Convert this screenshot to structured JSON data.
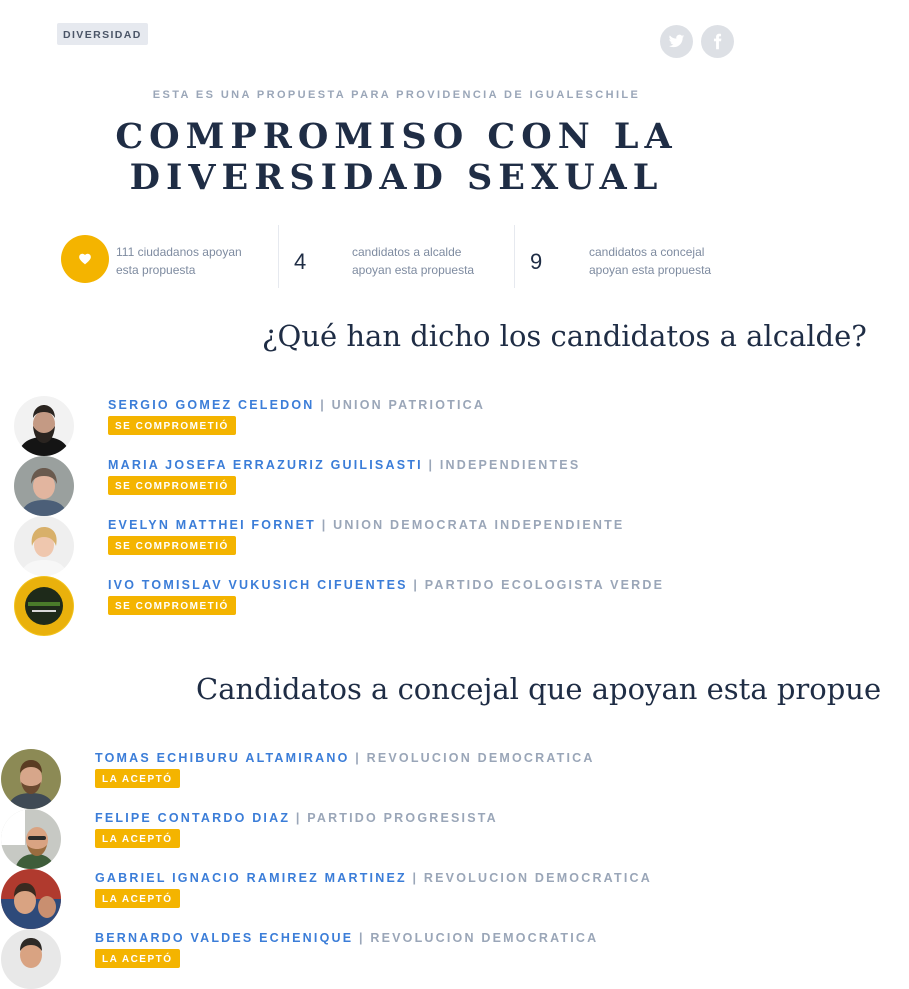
{
  "tag": "DIVERSIDAD",
  "social": {
    "twitter_icon": "twitter-icon",
    "facebook_icon": "facebook-icon"
  },
  "kicker": "ESTA ES UNA PROPUESTA PARA PROVIDENCIA DE IGUALESCHILE",
  "title_line1": "COMPROMISO CON LA",
  "title_line2": "DIVERSIDAD SEXUAL",
  "stats": {
    "citizens": "111 ciudadanos apoyan esta propuesta",
    "mayor_count": "4",
    "mayor_label": "candidatos a alcalde apoyan esta propuesta",
    "council_count": "9",
    "council_label": "candidatos a concejal apoyan esta propuesta"
  },
  "mayor_section": {
    "heading": "¿Qué han dicho los candidatos a alcalde?",
    "candidates": [
      {
        "name": "SERGIO GOMEZ CELEDON",
        "sep": "|",
        "party": "UNION PATRIOTICA",
        "badge": "SE COMPROMETIÓ"
      },
      {
        "name": "MARIA JOSEFA ERRAZURIZ GUILISASTI",
        "sep": "|",
        "party": "INDEPENDIENTES",
        "badge": "SE COMPROMETIÓ"
      },
      {
        "name": "EVELYN MATTHEI FORNET",
        "sep": "|",
        "party": "UNION DEMOCRATA INDEPENDIENTE",
        "badge": "SE COMPROMETIÓ"
      },
      {
        "name": "IVO TOMISLAV VUKUSICH CIFUENTES",
        "sep": "|",
        "party": "PARTIDO ECOLOGISTA VERDE",
        "badge": "SE COMPROMETIÓ"
      }
    ]
  },
  "council_section": {
    "heading": "Candidatos a concejal que apoyan esta propue",
    "candidates": [
      {
        "name": "TOMAS ECHIBURU ALTAMIRANO",
        "sep": "|",
        "party": "REVOLUCION DEMOCRATICA",
        "badge": "LA ACEPTÓ"
      },
      {
        "name": "FELIPE CONTARDO DIAZ",
        "sep": "|",
        "party": "PARTIDO PROGRESISTA",
        "badge": "LA ACEPTÓ"
      },
      {
        "name": "GABRIEL IGNACIO RAMIREZ MARTINEZ",
        "sep": "|",
        "party": "REVOLUCION DEMOCRATICA",
        "badge": "LA ACEPTÓ"
      },
      {
        "name": "BERNARDO VALDES ECHENIQUE",
        "sep": "|",
        "party": "REVOLUCION DEMOCRATICA",
        "badge": "LA ACEPTÓ"
      }
    ]
  }
}
